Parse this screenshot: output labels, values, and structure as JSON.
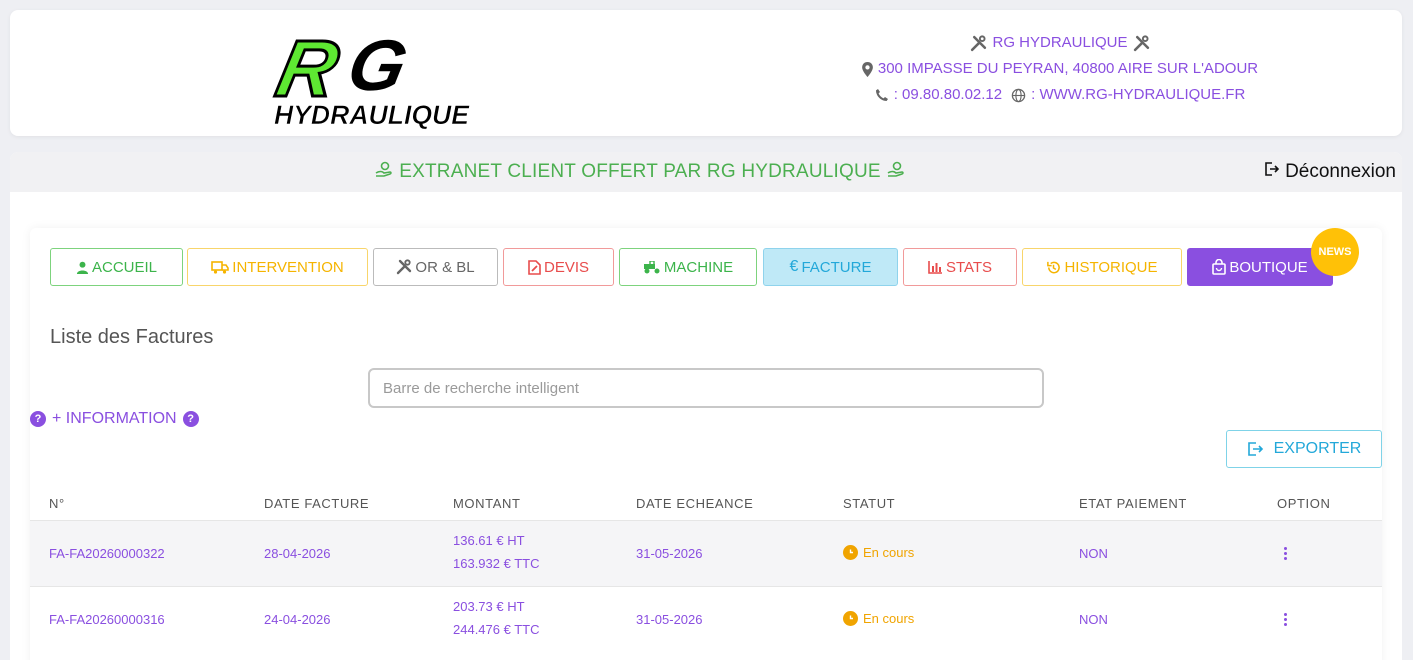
{
  "header": {
    "logo_top": "RG",
    "logo_bottom": "HYDRAULIQUE",
    "company_name": "RG HYDRAULIQUE",
    "address": "300 IMPASSE DU PEYRAN, 40800 AIRE SUR L'ADOUR",
    "phone": ": 09.80.80.02.12",
    "website": ": WWW.RG-HYDRAULIQUE.FR"
  },
  "banner": {
    "title": "EXTRANET CLIENT OFFERT PAR RG HYDRAULIQUE",
    "logout_label": "Déconnexion"
  },
  "nav": {
    "items": [
      {
        "label": "ACCUEIL",
        "icon": "user-icon"
      },
      {
        "label": "INTERVENTION",
        "icon": "truck-icon"
      },
      {
        "label": "OR & BL",
        "icon": "tools-icon"
      },
      {
        "label": "DEVIS",
        "icon": "file-edit-icon"
      },
      {
        "label": "MACHINE",
        "icon": "tractor-icon"
      },
      {
        "label": "FACTURE",
        "icon": "euro-icon"
      },
      {
        "label": "STATS",
        "icon": "bar-chart-icon"
      },
      {
        "label": "HISTORIQUE",
        "icon": "history-icon"
      },
      {
        "label": "BOUTIQUE",
        "icon": "shopping-bag-icon"
      }
    ],
    "news_badge": "NEWS",
    "colors": {
      "accueil": "#3cb44b",
      "intervention": "#f5b400",
      "orbl": "#666666",
      "devis": "#e84c4c",
      "machine": "#3cb44b",
      "facture": "#23a8d9",
      "stats": "#e84c4c",
      "historique": "#f5b400",
      "boutique": "#8a4fe0"
    }
  },
  "main": {
    "list_title": "Liste des Factures",
    "search_placeholder": "Barre de recherche intelligent",
    "search_value": "",
    "info_link": "+ INFORMATION",
    "export_label": "EXPORTER"
  },
  "table": {
    "columns": [
      "N°",
      "DATE FACTURE",
      "MONTANT",
      "DATE ECHEANCE",
      "STATUT",
      "ETAT PAIEMENT",
      "OPTION"
    ],
    "rows": [
      {
        "number": "FA-FA20260000322",
        "date": "28-04-2026",
        "amount_ht": "136.61 € HT",
        "amount_ttc": "163.932 € TTC",
        "due_date": "31-05-2026",
        "status": "En cours",
        "payment": "NON"
      },
      {
        "number": "FA-FA20260000316",
        "date": "24-04-2026",
        "amount_ht": "203.73 € HT",
        "amount_ttc": "244.476 € TTC",
        "due_date": "31-05-2026",
        "status": "En cours",
        "payment": "NON"
      }
    ]
  }
}
